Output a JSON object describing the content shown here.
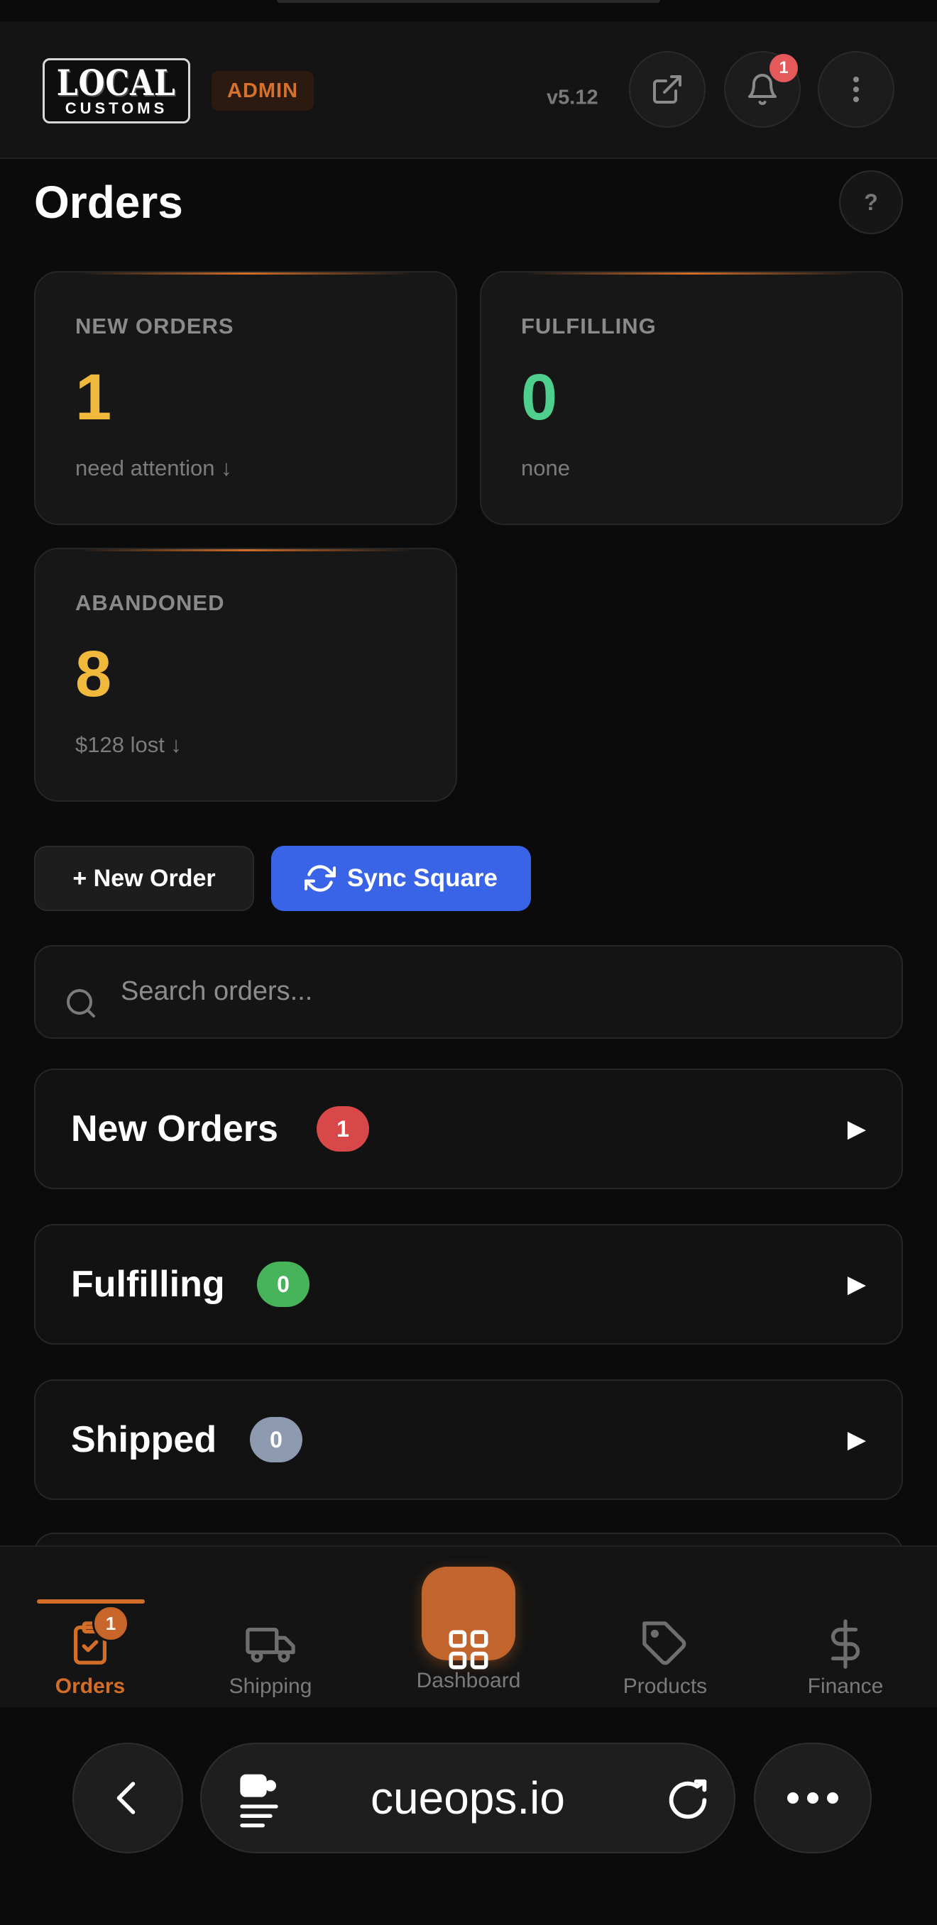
{
  "header": {
    "logo_main": "LOCAL",
    "logo_sub": "CUSTOMS",
    "role_badge": "ADMIN",
    "version": "v5.12",
    "notification_count": "1"
  },
  "page": {
    "title": "Orders",
    "help_label": "?"
  },
  "stats": [
    {
      "label": "NEW ORDERS",
      "value": "1",
      "sub": "need attention ↓",
      "color": "#f0b93c"
    },
    {
      "label": "FULFILLING",
      "value": "0",
      "sub": "none",
      "color": "#4fcf8e"
    },
    {
      "label": "ABANDONED",
      "value": "8",
      "sub": "$128 lost ↓",
      "color": "#f0b93c"
    }
  ],
  "actions": {
    "new_order": "+ New Order",
    "sync": "Sync Square"
  },
  "search": {
    "placeholder": "Search orders..."
  },
  "sections": [
    {
      "title": "New Orders",
      "count": "1",
      "badge_color": "#d94848"
    },
    {
      "title": "Fulfilling",
      "count": "0",
      "badge_color": "#47b35a"
    },
    {
      "title": "Shipped",
      "count": "0",
      "badge_color": "#8e9ab0"
    }
  ],
  "tabbar": {
    "orders": "Orders",
    "orders_badge": "1",
    "shipping": "Shipping",
    "dashboard": "Dashboard",
    "products": "Products",
    "finance": "Finance",
    "accent": "#d26e28"
  },
  "browser": {
    "url": "cueops.io"
  }
}
